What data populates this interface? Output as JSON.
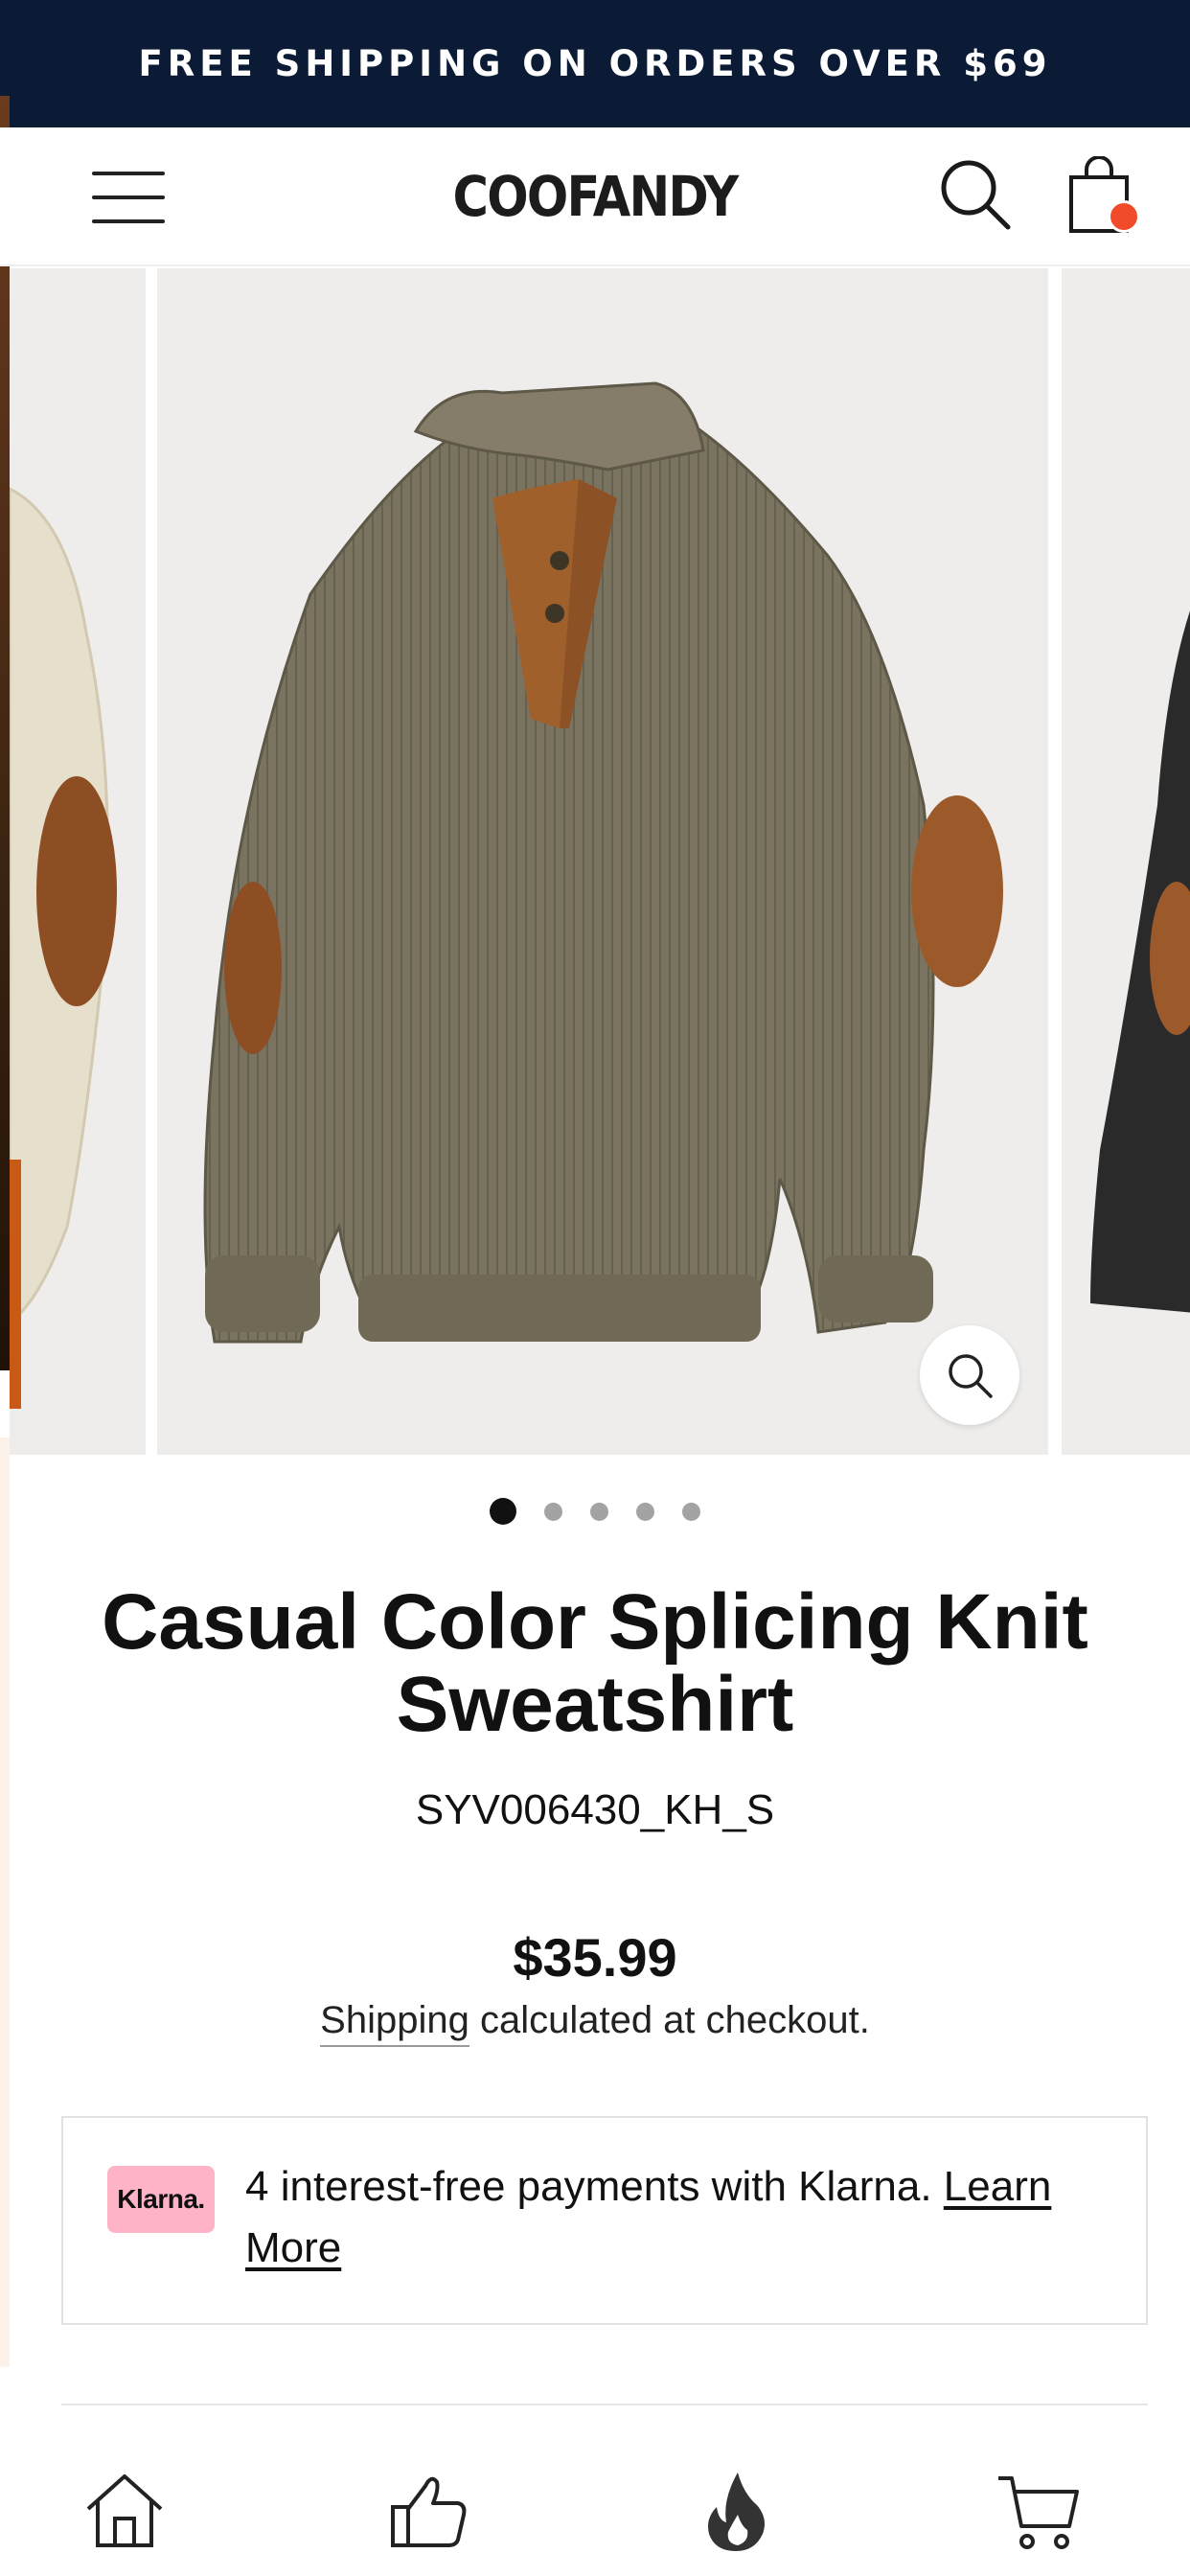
{
  "announcement": {
    "text": "FREE SHIPPING ON ORDERS OVER $69"
  },
  "header": {
    "logo": "COOFANDY",
    "cart_badge_color": "#f24b2b"
  },
  "gallery": {
    "slide_count": 5,
    "active_index": 0,
    "colors": {
      "main_sweater": "#7a7360",
      "patch": "#9c5a2a",
      "background": "#efedeb"
    }
  },
  "product": {
    "title": "Casual Color Splicing Knit Sweatshirt",
    "sku": "SYV006430_KH_S",
    "price": "$35.99",
    "shipping_link": "Shipping",
    "shipping_rest": " calculated at checkout."
  },
  "klarna": {
    "badge": "Klarna.",
    "text": "4 interest-free payments with Klarna. ",
    "link": "Learn More"
  },
  "bottom_nav": {
    "items": [
      {
        "icon": "home-icon"
      },
      {
        "icon": "thumbs-up-icon"
      },
      {
        "icon": "fire-icon"
      },
      {
        "icon": "cart-icon"
      }
    ]
  }
}
